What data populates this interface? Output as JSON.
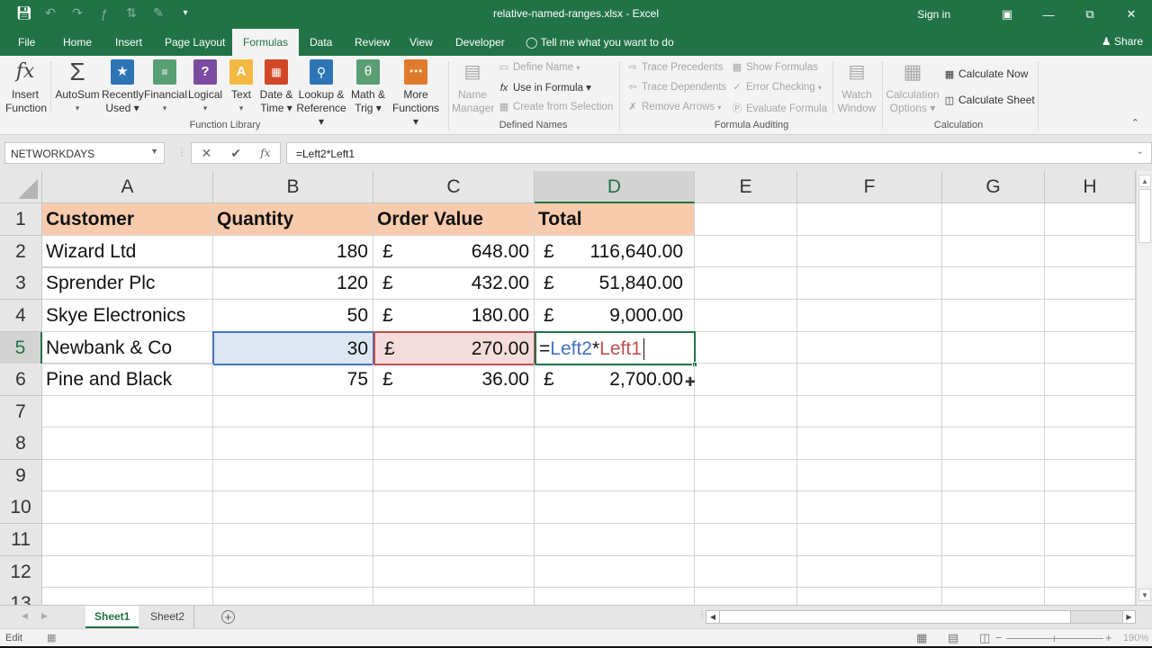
{
  "window": {
    "title": "relative-named-ranges.xlsx - Excel",
    "sign_in": "Sign in",
    "share": "Share"
  },
  "ribbon_tabs": [
    {
      "label": "File"
    },
    {
      "label": "Home"
    },
    {
      "label": "Insert"
    },
    {
      "label": "Page Layout"
    },
    {
      "label": "Formulas",
      "active": true
    },
    {
      "label": "Data"
    },
    {
      "label": "Review"
    },
    {
      "label": "View"
    },
    {
      "label": "Developer"
    }
  ],
  "tell_me": "Tell me what you want to do",
  "ribbon": {
    "function_library": {
      "group_label": "Function Library",
      "insert_function": {
        "line1": "Insert",
        "line2": "Function"
      },
      "autosum": {
        "line1": "AutoSum",
        "line2": "▾"
      },
      "recently_used": {
        "line1": "Recently",
        "line2": "Used ▾"
      },
      "financial": {
        "line1": "Financial",
        "line2": "▾"
      },
      "logical": {
        "line1": "Logical",
        "line2": "▾"
      },
      "text": {
        "line1": "Text",
        "line2": "▾"
      },
      "date_time": {
        "line1": "Date &",
        "line2": "Time ▾"
      },
      "lookup_reference": {
        "line1": "Lookup &",
        "line2": "Reference ▾"
      },
      "math_trig": {
        "line1": "Math &",
        "line2": "Trig ▾"
      },
      "more_functions": {
        "line1": "More",
        "line2": "Functions ▾"
      }
    },
    "defined_names": {
      "group_label": "Defined Names",
      "name_manager": {
        "line1": "Name",
        "line2": "Manager"
      },
      "define_name": "Define Name",
      "use_in_formula": "Use in Formula ▾",
      "create_from_selection": "Create from Selection"
    },
    "formula_auditing": {
      "group_label": "Formula Auditing",
      "trace_precedents": "Trace Precedents",
      "trace_dependents": "Trace Dependents",
      "remove_arrows": "Remove Arrows",
      "show_formulas": "Show Formulas",
      "error_checking": "Error Checking",
      "evaluate_formula": "Evaluate Formula",
      "watch_window": {
        "line1": "Watch",
        "line2": "Window"
      }
    },
    "calculation": {
      "group_label": "Calculation",
      "calculation_options": {
        "line1": "Calculation",
        "line2": "Options ▾"
      },
      "calculate_now": "Calculate Now",
      "calculate_sheet": "Calculate Sheet"
    }
  },
  "formula_bar": {
    "name_box": "NETWORKDAYS",
    "formula": "=Left2*Left1"
  },
  "columns": [
    "A",
    "B",
    "C",
    "D",
    "E",
    "F",
    "G",
    "H"
  ],
  "rows": [
    "1",
    "2",
    "3",
    "4",
    "5",
    "6",
    "7",
    "8",
    "9",
    "10",
    "11",
    "12",
    "13"
  ],
  "sheet": {
    "headers": [
      "Customer",
      "Quantity",
      "Order Value",
      "Total"
    ],
    "currency": "£",
    "data": [
      {
        "customer": "Wizard Ltd",
        "quantity": "180",
        "order_value": "648.00",
        "total": "116,640.00"
      },
      {
        "customer": "Sprender Plc",
        "quantity": "120",
        "order_value": "432.00",
        "total": "51,840.00"
      },
      {
        "customer": "Skye Electronics",
        "quantity": "50",
        "order_value": "180.00",
        "total": "9,000.00"
      },
      {
        "customer": "Newbank & Co",
        "quantity": "30",
        "order_value": "270.00",
        "total": null
      },
      {
        "customer": "Pine and Black",
        "quantity": "75",
        "order_value": "36.00",
        "total": "2,700.00"
      }
    ],
    "editing_formula": {
      "eq": "=",
      "ref1": "Left2",
      "op": "*",
      "ref2": "Left1"
    }
  },
  "sheet_tabs": [
    {
      "label": "Sheet1",
      "active": true
    },
    {
      "label": "Sheet2"
    }
  ],
  "status": {
    "mode": "Edit",
    "zoom": "190%"
  },
  "colors": {
    "excel_green": "#217346",
    "header_fill": "#f8cbad",
    "ref1_color": "#4472c4",
    "ref2_color": "#c0504d"
  }
}
